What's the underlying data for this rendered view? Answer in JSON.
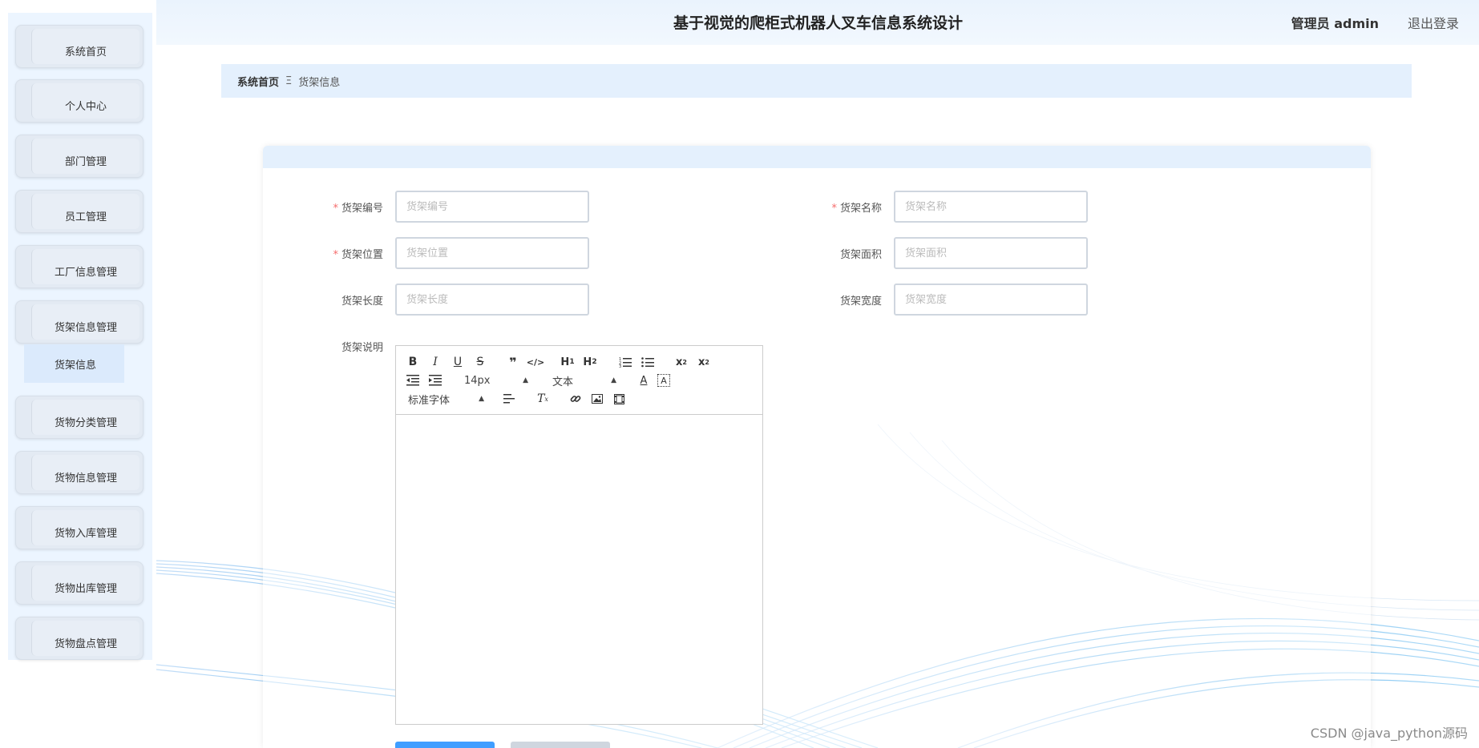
{
  "header": {
    "title": "基于视觉的爬柜式机器人叉车信息系统设计",
    "user": "管理员 admin",
    "logout": "退出登录"
  },
  "sidebar": {
    "items": [
      {
        "label": "系统首页"
      },
      {
        "label": "个人中心"
      },
      {
        "label": "部门管理"
      },
      {
        "label": "员工管理"
      },
      {
        "label": "工厂信息管理"
      },
      {
        "label": "货架信息管理"
      },
      {
        "label": "货物分类管理"
      },
      {
        "label": "货物信息管理"
      },
      {
        "label": "货物入库管理"
      },
      {
        "label": "货物出库管理"
      },
      {
        "label": "货物盘点管理"
      }
    ],
    "submenu": {
      "label": "货架信息"
    }
  },
  "breadcrumb": {
    "home": "系统首页",
    "separator": "Ξ",
    "current": "货架信息"
  },
  "form": {
    "shelf_no": {
      "label": "货架编号",
      "placeholder": "货架编号",
      "required": true
    },
    "shelf_name": {
      "label": "货架名称",
      "placeholder": "货架名称",
      "required": true
    },
    "shelf_location": {
      "label": "货架位置",
      "placeholder": "货架位置",
      "required": true
    },
    "shelf_area": {
      "label": "货架面积",
      "placeholder": "货架面积",
      "required": false
    },
    "shelf_length": {
      "label": "货架长度",
      "placeholder": "货架长度",
      "required": false
    },
    "shelf_width": {
      "label": "货架宽度",
      "placeholder": "货架宽度",
      "required": false
    },
    "shelf_desc": {
      "label": "货架说明"
    }
  },
  "editor": {
    "font_size": "14px",
    "block_type": "文本",
    "font_family": "标准字体",
    "icons": [
      "bold-icon",
      "italic-icon",
      "underline-icon",
      "strike-icon",
      "blockquote-icon",
      "code-block-icon",
      "header1-icon",
      "header2-icon",
      "ordered-list-icon",
      "bullet-list-icon",
      "subscript-icon",
      "superscript-icon",
      "outdent-icon",
      "indent-icon",
      "font-color-icon",
      "background-color-icon",
      "align-icon",
      "clear-format-icon",
      "link-icon",
      "image-icon",
      "video-icon"
    ]
  },
  "watermark": "CSDN @java_python源码",
  "colors": {
    "accent": "#409eff",
    "panel_bg": "#ecf5ff",
    "header_bg": "#eaf3fd",
    "required": "#f56c6c"
  }
}
